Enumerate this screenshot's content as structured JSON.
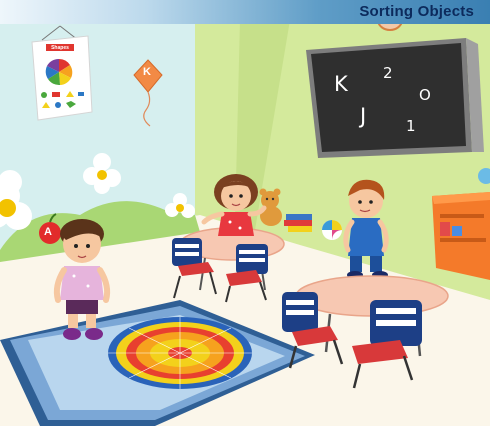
{
  "title": "Sorting Objects",
  "poster": {
    "label": "Shapes"
  },
  "chalkboard": {
    "letters": [
      "K",
      "2",
      "O",
      "J",
      "1"
    ]
  },
  "kite": {
    "letter": "K"
  },
  "apple": {
    "letter": "A"
  },
  "colors": {
    "title_text": "#0c2a5c",
    "wall_left": "#d6efef",
    "wall_right": "#d4ea9c",
    "floor": "#fbf6ea",
    "rug": "#7ba7d6",
    "table_top": "#f7c8b2",
    "chair": "#1d3f86"
  }
}
